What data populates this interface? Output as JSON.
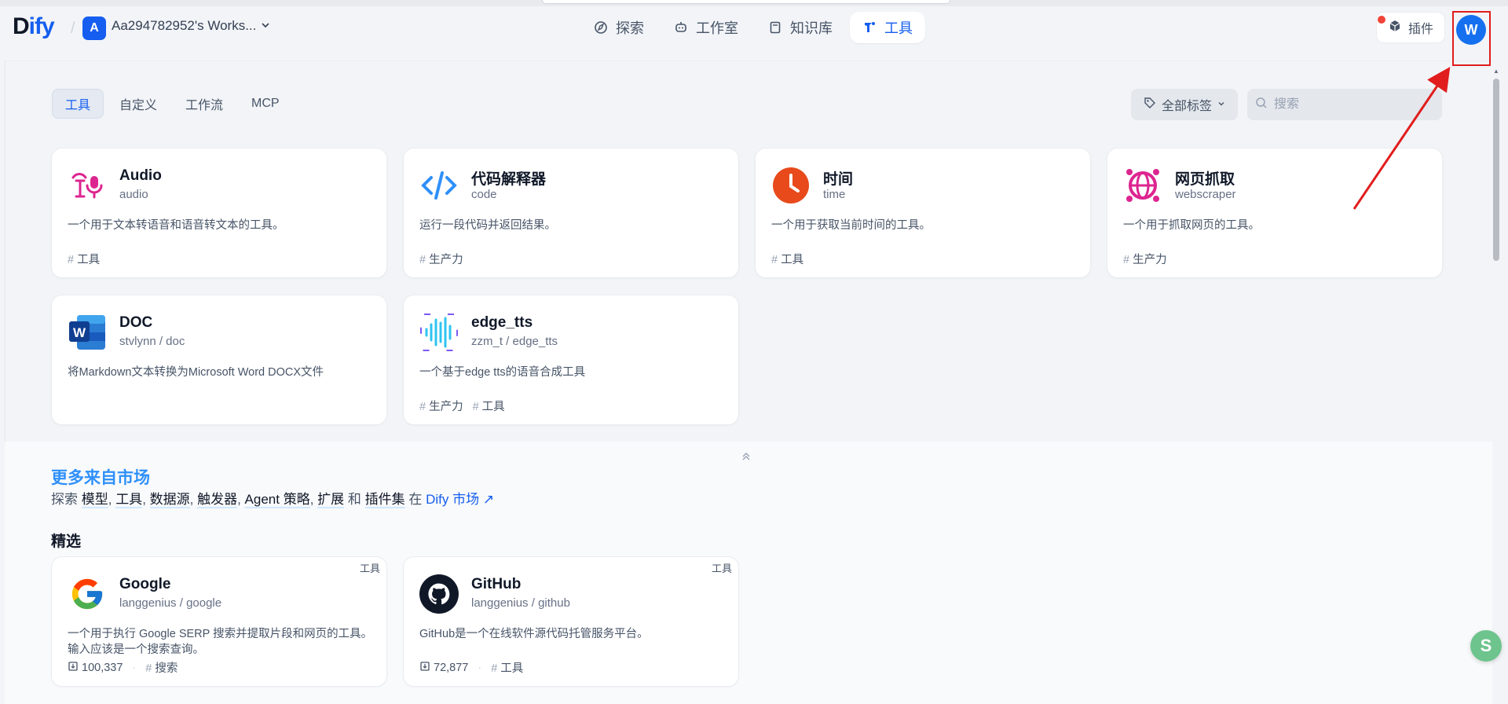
{
  "header": {
    "logo_main": "D",
    "logo_accent": "ify",
    "workspace_badge": "A",
    "workspace_name": "Aa294782952's Works...",
    "nav": [
      {
        "label": "探索",
        "icon": "compass-icon"
      },
      {
        "label": "工作室",
        "icon": "robot-icon"
      },
      {
        "label": "知识库",
        "icon": "book-icon"
      },
      {
        "label": "工具",
        "icon": "tool-icon",
        "active": true
      }
    ],
    "plugin_label": "插件",
    "avatar_letter": "W"
  },
  "tools": {
    "tabs": [
      {
        "label": "工具",
        "active": true
      },
      {
        "label": "自定义"
      },
      {
        "label": "工作流"
      },
      {
        "label": "MCP"
      }
    ],
    "tag_filter_label": "全部标签",
    "search_placeholder": "搜索",
    "cards": [
      {
        "title": "Audio",
        "subtitle": "audio",
        "desc": "一个用于文本转语音和语音转文本的工具。",
        "tags": [
          "工具"
        ],
        "icon": "audio-icon"
      },
      {
        "title": "代码解释器",
        "subtitle": "code",
        "desc": "运行一段代码并返回结果。",
        "tags": [
          "生产力"
        ],
        "icon": "code-icon"
      },
      {
        "title": "时间",
        "subtitle": "time",
        "desc": "一个用于获取当前时间的工具。",
        "tags": [
          "工具"
        ],
        "icon": "clock-icon"
      },
      {
        "title": "网页抓取",
        "subtitle": "webscraper",
        "desc": "一个用于抓取网页的工具。",
        "tags": [
          "生产力"
        ],
        "icon": "globe-icon"
      },
      {
        "title": "DOC",
        "subtitle": "stvlynn / doc",
        "desc": "将Markdown文本转换为Microsoft Word DOCX文件",
        "tags": [],
        "icon": "word-icon"
      },
      {
        "title": "edge_tts",
        "subtitle": "zzm_t / edge_tts",
        "desc": "一个基于edge tts的语音合成工具",
        "tags": [
          "生产力",
          "工具"
        ],
        "icon": "waveform-icon"
      }
    ]
  },
  "market": {
    "title": "更多来自市场",
    "sub_prefix": "探索",
    "sub_kw1": "模型",
    "sub_kw2": "工具",
    "sub_kw3": "数据源",
    "sub_kw4": "触发器",
    "sub_kw5": "Agent 策略",
    "sub_kw6": "扩展",
    "sub_and": "和",
    "sub_kw7": "插件集",
    "sub_in": "在",
    "sub_link": "Dify 市场 ↗",
    "featured_label": "精选",
    "cards": [
      {
        "title": "Google",
        "subtitle": "langgenius / google",
        "badge": "工具",
        "desc": "一个用于执行 Google SERP 搜索并提取片段和网页的工具。输入应该是一个搜索查询。",
        "downloads": "100,337",
        "tag": "搜索",
        "icon": "google-icon"
      },
      {
        "title": "GitHub",
        "subtitle": "langgenius / github",
        "badge": "工具",
        "desc": "GitHub是一个在线软件源代码托管服务平台。",
        "downloads": "72,877",
        "tag": "工具",
        "icon": "github-icon"
      }
    ]
  },
  "colors": {
    "accent": "#155eef",
    "annotation_red": "#e11d1d"
  }
}
